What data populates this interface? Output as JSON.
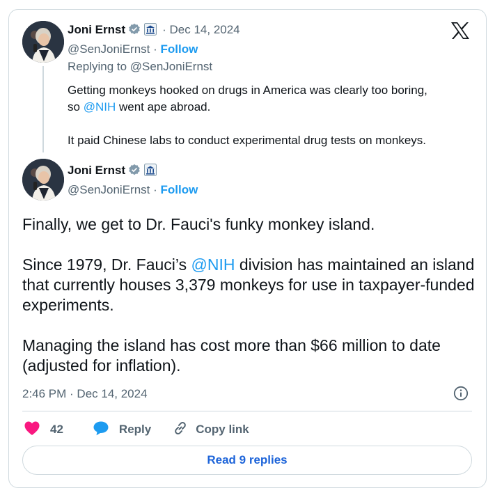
{
  "quoted_tweet": {
    "author_name": "Joni Ernst",
    "date": "· Dec 14, 2024",
    "handle": "@SenJoniErnst",
    "separator": " · ",
    "follow_label": "Follow",
    "replying_to": "Replying to @SenJoniErnst",
    "text_line1": "Getting monkeys hooked on drugs in America was clearly too boring,",
    "text_line2_pre": "so ",
    "text_line2_mention": "@NIH",
    "text_line2_post": " went ape abroad.",
    "text_line3": "It paid Chinese labs to conduct experimental drug tests on monkeys."
  },
  "main_tweet": {
    "author_name": "Joni Ernst",
    "handle": "@SenJoniErnst",
    "separator": " · ",
    "follow_label": "Follow",
    "para1": "Finally, we get to Dr. Fauci's funky monkey island.",
    "para2_pre": "Since 1979, Dr. Fauci’s ",
    "para2_mention": "@NIH",
    "para2_post": " division has maintained an island that currently houses 3,379 monkeys for use in taxpayer-funded experiments.",
    "para3": "Managing the island has cost more than $66 million to date (adjusted for inflation).",
    "timestamp": "2:46 PM · Dec 14, 2024"
  },
  "actions": {
    "likes_count": "42",
    "reply_label": "Reply",
    "copy_label": "Copy link"
  },
  "read_replies_label": "Read 9 replies",
  "icons": {
    "brand": "x-logo-icon",
    "verified": "verified-badge-icon",
    "government": "government-building-icon",
    "info": "info-icon",
    "like": "heart-icon",
    "reply": "speech-bubble-icon",
    "copy": "link-icon"
  },
  "colors": {
    "accent": "#1d9bf0",
    "like": "#f91880",
    "border": "#cfd9de",
    "muted": "#536471"
  }
}
